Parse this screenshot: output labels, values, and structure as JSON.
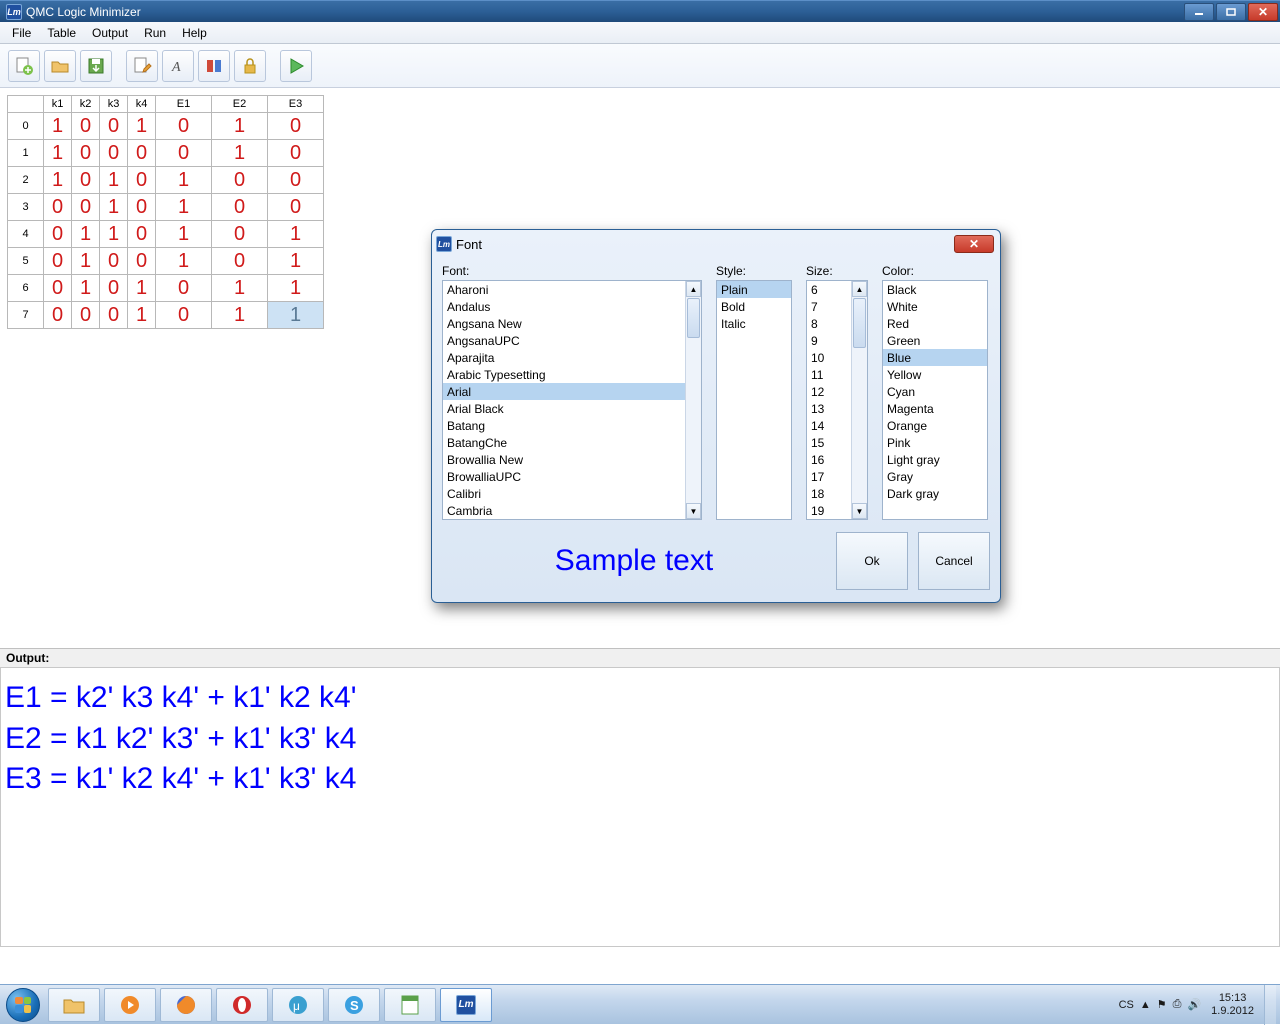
{
  "window": {
    "title": "QMC Logic Minimizer",
    "app_icon_text": "Lm"
  },
  "menu": [
    "File",
    "Table",
    "Output",
    "Run",
    "Help"
  ],
  "toolbar_icons": [
    "new-file-icon",
    "open-folder-icon",
    "save-icon",
    "edit-icon",
    "font-icon",
    "settings-icon",
    "lock-icon",
    "run-icon"
  ],
  "truth_table": {
    "input_headers": [
      "k1",
      "k2",
      "k3",
      "k4"
    ],
    "output_headers": [
      "E1",
      "E2",
      "E3"
    ],
    "rows": [
      {
        "idx": "0",
        "k": [
          "1",
          "0",
          "0",
          "1"
        ],
        "e": [
          "0",
          "1",
          "0"
        ]
      },
      {
        "idx": "1",
        "k": [
          "1",
          "0",
          "0",
          "0"
        ],
        "e": [
          "0",
          "1",
          "0"
        ]
      },
      {
        "idx": "2",
        "k": [
          "1",
          "0",
          "1",
          "0"
        ],
        "e": [
          "1",
          "0",
          "0"
        ]
      },
      {
        "idx": "3",
        "k": [
          "0",
          "0",
          "1",
          "0"
        ],
        "e": [
          "1",
          "0",
          "0"
        ]
      },
      {
        "idx": "4",
        "k": [
          "0",
          "1",
          "1",
          "0"
        ],
        "e": [
          "1",
          "0",
          "1"
        ]
      },
      {
        "idx": "5",
        "k": [
          "0",
          "1",
          "0",
          "0"
        ],
        "e": [
          "1",
          "0",
          "1"
        ]
      },
      {
        "idx": "6",
        "k": [
          "0",
          "1",
          "0",
          "1"
        ],
        "e": [
          "0",
          "1",
          "1"
        ]
      },
      {
        "idx": "7",
        "k": [
          "0",
          "0",
          "0",
          "1"
        ],
        "e": [
          "0",
          "1",
          "1"
        ]
      }
    ],
    "selected": {
      "row": 7,
      "col": "E3"
    }
  },
  "dialog": {
    "title": "Font",
    "labels": {
      "font": "Font:",
      "style": "Style:",
      "size": "Size:",
      "color": "Color:"
    },
    "fonts": [
      "Aharoni",
      "Andalus",
      "Angsana New",
      "AngsanaUPC",
      "Aparajita",
      "Arabic Typesetting",
      "Arial",
      "Arial Black",
      "Batang",
      "BatangChe",
      "Browallia New",
      "BrowalliaUPC",
      "Calibri",
      "Cambria"
    ],
    "font_selected": "Arial",
    "styles": [
      "Plain",
      "Bold",
      "Italic"
    ],
    "style_selected": "Plain",
    "sizes": [
      "6",
      "7",
      "8",
      "9",
      "10",
      "11",
      "12",
      "13",
      "14",
      "15",
      "16",
      "17",
      "18",
      "19"
    ],
    "size_selected": "",
    "colors": [
      "Black",
      "White",
      "Red",
      "Green",
      "Blue",
      "Yellow",
      "Cyan",
      "Magenta",
      "Orange",
      "Pink",
      "Light gray",
      "Gray",
      "Dark gray"
    ],
    "color_selected": "Blue",
    "sample_text": "Sample text",
    "ok_label": "Ok",
    "cancel_label": "Cancel"
  },
  "output": {
    "label": "Output:",
    "equations": [
      "E1   =   k2' k3 k4'   +   k1' k2 k4'",
      "E2   =   k1 k2' k3'   +   k1' k3' k4",
      "E3   =   k1' k2 k4'   +   k1' k3' k4"
    ]
  },
  "taskbar": {
    "lang": "CS",
    "time": "15:13",
    "date": "1.9.2012"
  }
}
